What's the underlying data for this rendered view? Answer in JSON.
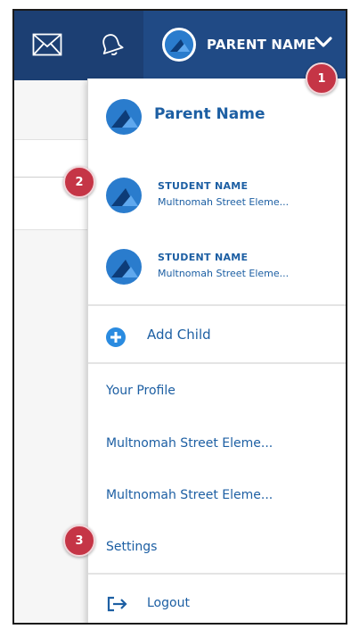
{
  "header": {
    "account_name": "PARENT NAME",
    "icons": {
      "mail": "envelope-icon",
      "notifications": "bell-icon",
      "account_menu": "chevron-down-icon"
    },
    "colors": {
      "bar": "#1c3f73",
      "account_area": "#204a85"
    }
  },
  "menu": {
    "parent": {
      "name": "Parent Name"
    },
    "students": [
      {
        "name": "STUDENT NAME",
        "school": "Multnomah Street Eleme..."
      },
      {
        "name": "STUDENT NAME",
        "school": "Multnomah Street Eleme..."
      }
    ],
    "add_child_label": "Add Child",
    "links": [
      {
        "label": "Your Profile"
      },
      {
        "label": "Multnomah Street Eleme..."
      },
      {
        "label": "Multnomah Street Eleme..."
      },
      {
        "label": "Settings"
      }
    ],
    "logout_label": "Logout",
    "colors": {
      "link": "#1d5fa3",
      "avatar": "#2a7ccd"
    }
  },
  "annotations": {
    "badges": [
      "1",
      "2",
      "3"
    ],
    "color": "#c53546"
  }
}
